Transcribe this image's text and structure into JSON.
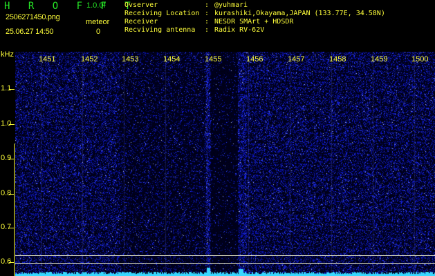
{
  "header": {
    "brand": "H R O F F T",
    "version": "1.0.0f",
    "filename": "2506271450.png",
    "datetime": "25.06.27 14:50",
    "meteor_label": "meteor",
    "meteor_count": "0"
  },
  "info": [
    {
      "key": "Ovserver",
      "value": "@yuhmari"
    },
    {
      "key": "Receiving Location",
      "value": "kurashiki,Okayama,JAPAN (133.77E, 34.58N)"
    },
    {
      "key": "Receiver",
      "value": "NESDR SMArt + HDSDR"
    },
    {
      "key": "Recviving antenna",
      "value": "Radix RV-62V"
    }
  ],
  "y_unit": "kHz",
  "y_labels": [
    "1.1",
    "1.0",
    "0.9",
    "0.8",
    "0.7",
    "0.6"
  ],
  "x_labels": [
    "1451",
    "1452",
    "1453",
    "1454",
    "1455",
    "1456",
    "1457",
    "1458",
    "1459",
    "1500"
  ],
  "colors": {
    "header_text": "#ffff3a",
    "brand": "#26e626",
    "noise": "#2a3cff",
    "trace": "#38d8ff"
  }
}
